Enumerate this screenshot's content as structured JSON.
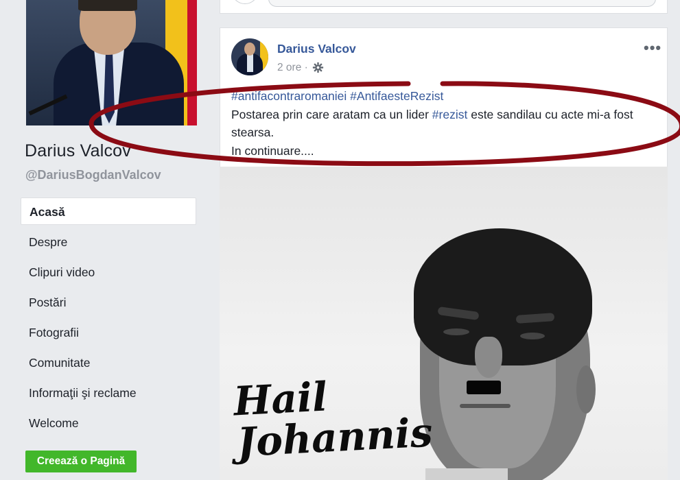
{
  "sidebar": {
    "page_name": "Darius Valcov",
    "handle": "@DariusBogdanValcov",
    "nav": [
      {
        "label": "Acasă",
        "active": true
      },
      {
        "label": "Despre"
      },
      {
        "label": "Clipuri video"
      },
      {
        "label": "Postări"
      },
      {
        "label": "Fotografii"
      },
      {
        "label": "Comunitate"
      },
      {
        "label": "Informaţii şi reclame"
      },
      {
        "label": "Welcome"
      }
    ],
    "create_page_button": "Creează o Pagină"
  },
  "post": {
    "author": "Darius Valcov",
    "time": "2 ore ·",
    "text": {
      "hashtag1": "#antifacontraromaniei",
      "hashtag2": "#AntifaesteRezist",
      "line2_a": "Postarea prin care aratam ca un lider ",
      "hashtag3": "#rezist",
      "line2_b": " este sandilau cu acte mi-a fost stearsa.",
      "line3": "In continuare...."
    },
    "image_text": {
      "line1": "Hail",
      "line2": "Johannis"
    }
  },
  "colors": {
    "link": "#365899",
    "accent_green": "#42b72a",
    "annotation_red": "#8b0b14"
  },
  "icons": {
    "privacy": "gear-icon",
    "menu": "more-icon"
  }
}
